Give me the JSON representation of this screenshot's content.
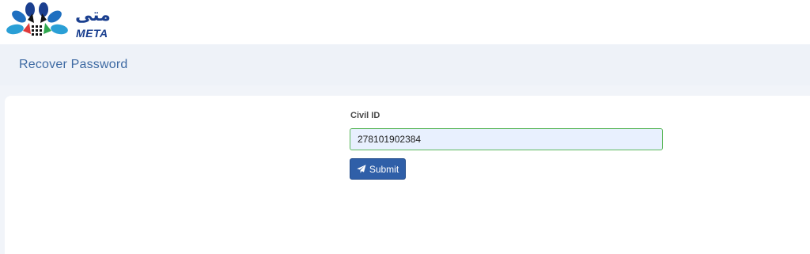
{
  "header": {
    "logo_arabic": "متى",
    "logo_english": "META"
  },
  "page": {
    "title": "Recover Password"
  },
  "form": {
    "civil_id_label": "Civil ID",
    "civil_id_value": "278101902384",
    "submit_label": "Submit",
    "submit_icon": "paper-plane-icon",
    "accent_color": "#2f5fa8",
    "valid_border_color": "#5cb85c"
  }
}
